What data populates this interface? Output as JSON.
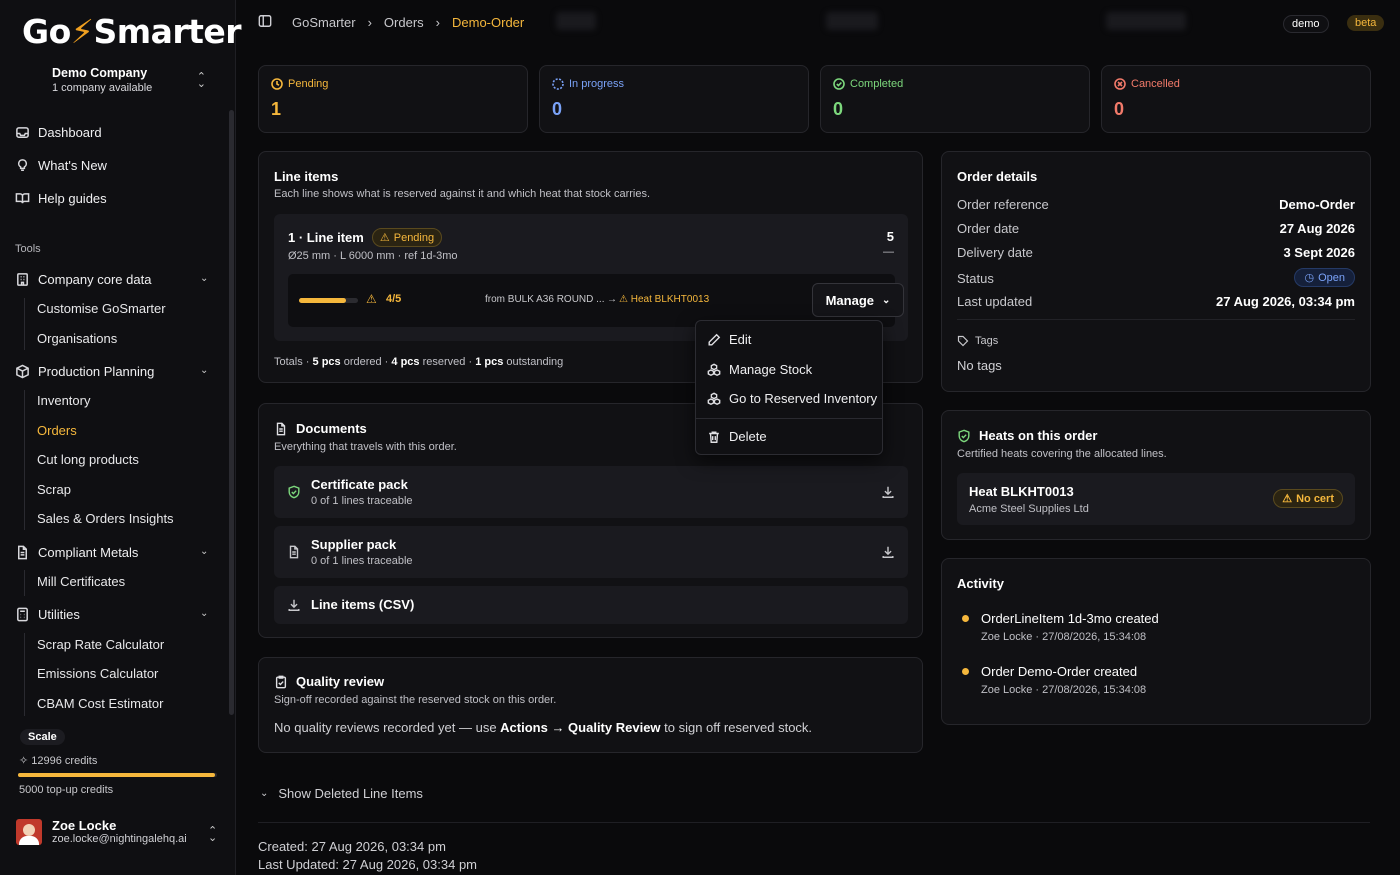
{
  "brand": {
    "logo_left": "Go",
    "logo_bolt": "⚡",
    "logo_right": "Smarter"
  },
  "company": {
    "name": "Demo Company",
    "subtitle": "1 company available"
  },
  "nav": {
    "dashboard": "Dashboard",
    "whats_new": "What's New",
    "help": "Help guides",
    "tools_label": "Tools",
    "company_core": "Company core data",
    "customise": "Customise GoSmarter",
    "organisations": "Organisations",
    "production": "Production Planning",
    "inventory": "Inventory",
    "orders": "Orders",
    "cut_long": "Cut long products",
    "scrap": "Scrap",
    "sales": "Sales & Orders Insights",
    "compliant": "Compliant Metals",
    "mill": "Mill Certificates",
    "utilities": "Utilities",
    "scrap_rate": "Scrap Rate Calculator",
    "emissions": "Emissions Calculator",
    "cbam": "CBAM Cost Estimator"
  },
  "plan": {
    "name": "Scale",
    "credits": "12996 credits",
    "credit_fraction": 0.99,
    "topup": "5000 top-up credits"
  },
  "user": {
    "name": "Zoe Locke",
    "email": "zoe.locke@nightingalehq.ai"
  },
  "breadcrumb": {
    "root": "GoSmarter",
    "section": "Orders",
    "current": "Demo-Order"
  },
  "env": {
    "demo": "demo",
    "beta": "beta"
  },
  "stats": [
    {
      "label": "Pending",
      "value": "1",
      "color": "#f5b73c"
    },
    {
      "label": "In progress",
      "value": "0",
      "color": "#7aa2f7"
    },
    {
      "label": "Completed",
      "value": "0",
      "color": "#7dd87d"
    },
    {
      "label": "Cancelled",
      "value": "0",
      "color": "#f27a6a"
    }
  ],
  "line_items": {
    "title": "Line items",
    "subtitle": "Each line shows what is reserved against it and which heat that stock carries.",
    "item": {
      "title": "1 · Line item",
      "status": "Pending",
      "spec": "Ø25 mm · L 6000 mm · ref 1d-3mo",
      "qty": "5",
      "qty_sub": "—",
      "reserved": "4/5",
      "reserved_fraction": 0.8,
      "source": "from BULK A36 ROUND ...",
      "arrow": "→",
      "heat": "Heat BLKHT0013",
      "manage": "Manage"
    },
    "totals_prefix": "Totals · ",
    "totals_ordered": "5 pcs",
    "totals_ordered_label": " ordered · ",
    "totals_reserved": "4 pcs",
    "totals_reserved_label": " reserved · ",
    "totals_outstanding": "1 pcs",
    "totals_outstanding_label": " outstanding"
  },
  "manage_menu": {
    "edit": "Edit",
    "manage_stock": "Manage Stock",
    "goto": "Go to Reserved Inventory",
    "delete": "Delete"
  },
  "documents": {
    "title": "Documents",
    "subtitle": "Everything that travels with this order.",
    "cert_title": "Certificate pack",
    "cert_sub": "0 of 1 lines traceable",
    "supplier_title": "Supplier pack",
    "supplier_sub": "0 of 1 lines traceable",
    "csv": "Line items (CSV)"
  },
  "quality": {
    "title": "Quality review",
    "subtitle": "Sign-off recorded against the reserved stock on this order.",
    "text1": "No quality reviews recorded yet — use ",
    "actions": "Actions → Quality Review",
    "text2": " to sign off reserved stock."
  },
  "order_details": {
    "title": "Order details",
    "rows": [
      {
        "k": "Order reference",
        "v": "Demo-Order"
      },
      {
        "k": "Order date",
        "v": "27 Aug 2026"
      },
      {
        "k": "Delivery date",
        "v": "3 Sept 2026"
      },
      {
        "k": "Status",
        "v": "Open"
      },
      {
        "k": "Last updated",
        "v": "27 Aug 2026, 03:34 pm"
      }
    ],
    "tags_label": "Tags",
    "tags_value": "No tags"
  },
  "heats": {
    "title": "Heats on this order",
    "subtitle": "Certified heats covering the allocated lines.",
    "heat": "Heat BLKHT0013",
    "supplier": "Acme Steel Supplies Ltd",
    "cert": "No cert"
  },
  "activity": {
    "title": "Activity",
    "items": [
      {
        "title": "OrderLineItem 1d-3mo created",
        "meta": "Zoe Locke · 27/08/2026, 15:34:08"
      },
      {
        "title": "Order Demo-Order created",
        "meta": "Zoe Locke · 27/08/2026, 15:34:08"
      }
    ]
  },
  "footer": {
    "show_deleted": "Show Deleted Line Items",
    "created": "Created: 27 Aug 2026, 03:34 pm",
    "updated": "Last Updated: 27 Aug 2026, 03:34 pm"
  }
}
